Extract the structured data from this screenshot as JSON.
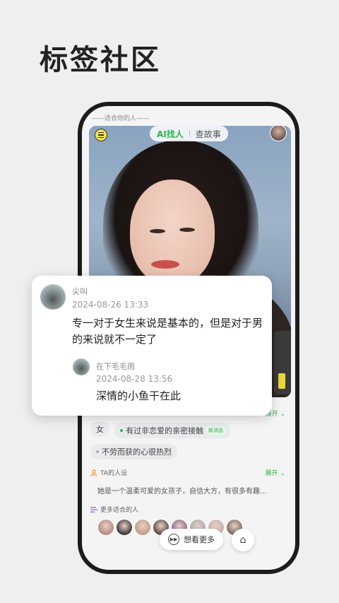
{
  "headline": "标签社区",
  "phone": {
    "hint": "——适合你的人——",
    "segment": {
      "active": "AI找人",
      "inactive": "查故事"
    },
    "tags": {
      "expand_label": "展开",
      "row1": [
        {
          "label": "女"
        },
        {
          "label": "有过非恋爱的亲密接触",
          "badge": "新消息"
        }
      ],
      "row2": [
        {
          "label": "不劳而获的心很热烈"
        }
      ]
    },
    "persona": {
      "title": "TA的人设",
      "expand_label": "展开",
      "text": "她是一个温柔可爱的女孩子，自信大方，有很多有趣..."
    },
    "more": {
      "title": "更多适合的人",
      "button_label": "想看更多",
      "avatar_colors": [
        "#b68a80",
        "#3a3636",
        "#c49a86",
        "#5a4a48",
        "#8a6a8a",
        "#a9a9b0",
        "#c7b1ad",
        "#7a6a60"
      ]
    }
  },
  "popup": {
    "comment": {
      "name": "尖叫",
      "date": "2024-08-26 13:33",
      "text": "专一对于女生来说是基本的，但是对于男的来说就不一定了"
    },
    "reply": {
      "name": "在下毛毛雨",
      "date": "2024-08-28 13:56",
      "text": "深情的小鱼干在此"
    }
  },
  "colors": {
    "accent": "#2bb34a",
    "frame": "#1c1c1c"
  }
}
